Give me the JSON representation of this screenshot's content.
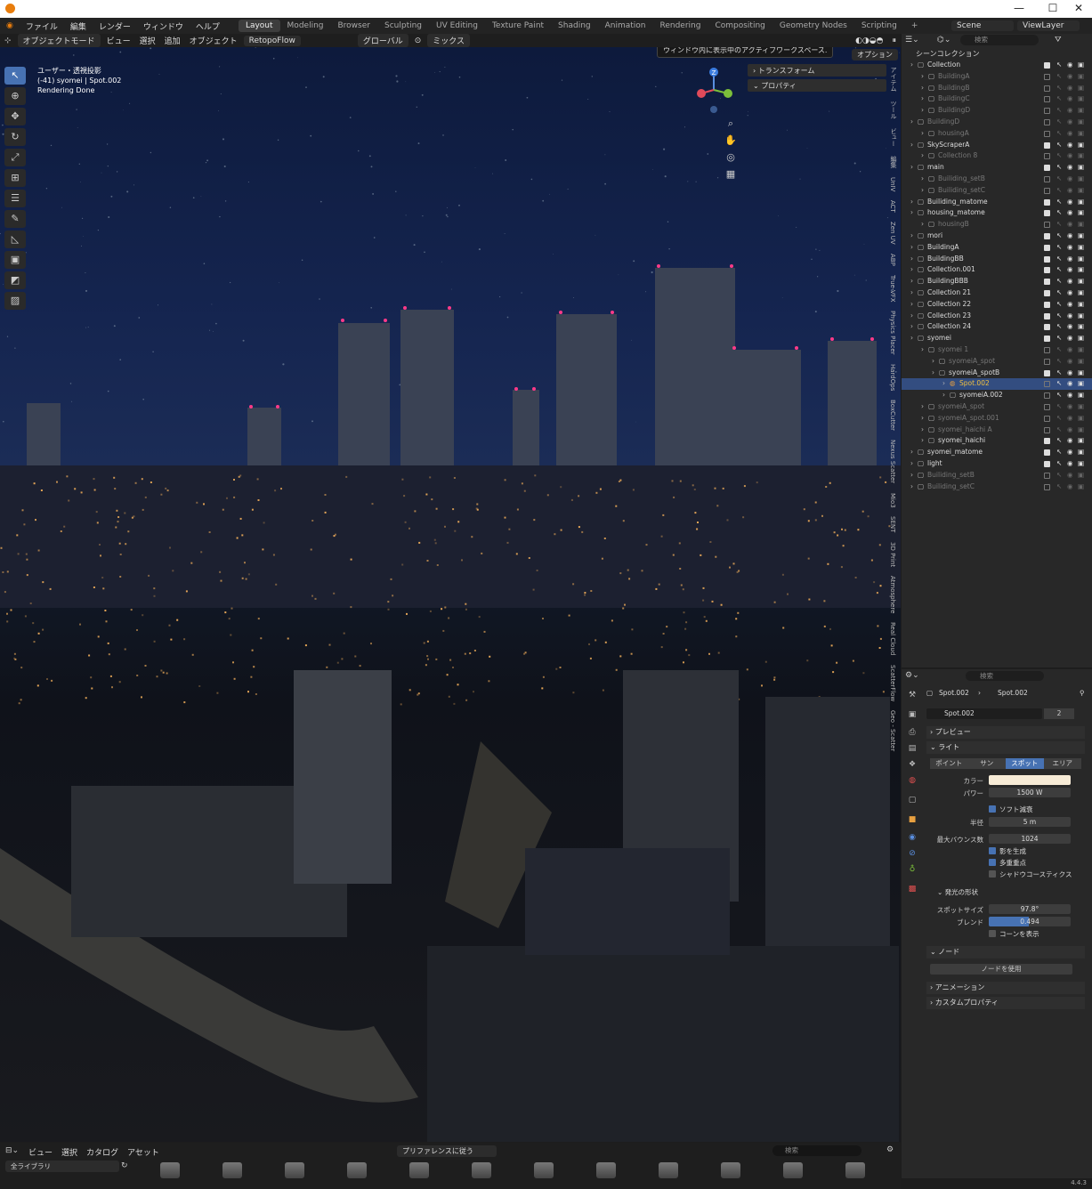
{
  "window": {
    "minimize": "—",
    "maximize": "☐",
    "close": "✕"
  },
  "menus": [
    "ファイル",
    "編集",
    "レンダー",
    "ウィンドウ",
    "ヘルプ"
  ],
  "workspaces": [
    "Layout",
    "Modeling",
    "Browser",
    "Sculpting",
    "UV Editing",
    "Texture Paint",
    "Shading",
    "Animation",
    "Rendering",
    "Compositing",
    "Geometry Nodes",
    "Scripting"
  ],
  "active_workspace": "Layout",
  "add_workspace": "+",
  "scene": {
    "name": "Scene",
    "view_layer": "ViewLayer"
  },
  "viewport_header": {
    "mode": "オブジェクトモード",
    "menu": [
      "ビュー",
      "選択",
      "追加",
      "オブジェクト"
    ],
    "addon": "RetopoFlow",
    "transform": "グローバル",
    "snap": "ミックス",
    "options": "オプション"
  },
  "tooltip": "ウィンドウ内に表示中のアクティブワークスペース.",
  "overlay": {
    "line1": "ユーザー・透視投影",
    "line2": "(-41) syomei | Spot.002",
    "line3": "Rendering Done"
  },
  "npanel": {
    "transform": "トランスフォーム",
    "properties": "プロパティ"
  },
  "gizmo": {
    "z": "Z"
  },
  "side_tabs": [
    "アイテム",
    "ツール",
    "ビュー",
    "編集",
    "UnIV",
    "ACT",
    "Zen UV",
    "ABP",
    "True-VFX",
    "Physics Placer",
    "HardOps",
    "BoxCutter",
    "Nexus Scatter",
    "Mio3",
    "SENT",
    "3D Print",
    "Atmosphere",
    "Real Cloud",
    "ScatterFlow",
    "Geo - Scatter"
  ],
  "outliner": {
    "search_placeholder": "検索",
    "root": "シーンコレクション",
    "rows": [
      {
        "name": "Collection",
        "indent": 1,
        "dim": false,
        "checked": true
      },
      {
        "name": "BuildingA",
        "indent": 2,
        "dim": true,
        "checked": false
      },
      {
        "name": "BuildingB",
        "indent": 2,
        "dim": true,
        "checked": false
      },
      {
        "name": "BuildingC",
        "indent": 2,
        "dim": true,
        "checked": false
      },
      {
        "name": "BuildingD",
        "indent": 2,
        "dim": true,
        "checked": false
      },
      {
        "name": "BuildingD",
        "indent": 1,
        "dim": true,
        "checked": false
      },
      {
        "name": "housingA",
        "indent": 2,
        "dim": true,
        "checked": false
      },
      {
        "name": "SkyScraperA",
        "indent": 1,
        "dim": false,
        "checked": true
      },
      {
        "name": "Collection 8",
        "indent": 2,
        "dim": true,
        "checked": false
      },
      {
        "name": "main",
        "indent": 1,
        "dim": false,
        "checked": true
      },
      {
        "name": "Builiding_setB",
        "indent": 2,
        "dim": true,
        "checked": false
      },
      {
        "name": "Builiding_setC",
        "indent": 2,
        "dim": true,
        "checked": false
      },
      {
        "name": "Builiding_matome",
        "indent": 1,
        "dim": false,
        "checked": true
      },
      {
        "name": "housing_matome",
        "indent": 1,
        "dim": false,
        "checked": true
      },
      {
        "name": "housingB",
        "indent": 2,
        "dim": true,
        "checked": false
      },
      {
        "name": "mori",
        "indent": 1,
        "dim": false,
        "checked": true
      },
      {
        "name": "BuildingA",
        "indent": 1,
        "dim": false,
        "checked": true
      },
      {
        "name": "BuildingBB",
        "indent": 1,
        "dim": false,
        "checked": true
      },
      {
        "name": "Collection.001",
        "indent": 1,
        "dim": false,
        "checked": true
      },
      {
        "name": "BuildingBBB",
        "indent": 1,
        "dim": false,
        "checked": true
      },
      {
        "name": "Collection 21",
        "indent": 1,
        "dim": false,
        "checked": true
      },
      {
        "name": "Collection 22",
        "indent": 1,
        "dim": false,
        "checked": true
      },
      {
        "name": "Collection 23",
        "indent": 1,
        "dim": false,
        "checked": true
      },
      {
        "name": "Collection 24",
        "indent": 1,
        "dim": false,
        "checked": true
      },
      {
        "name": "syomei",
        "indent": 1,
        "dim": false,
        "checked": true
      },
      {
        "name": "syomei 1",
        "indent": 2,
        "dim": true,
        "checked": false
      },
      {
        "name": "syomeiA_spot",
        "indent": 3,
        "dim": true,
        "checked": false
      },
      {
        "name": "syomeiA_spotB",
        "indent": 3,
        "dim": false,
        "checked": true
      },
      {
        "name": "Spot.002",
        "indent": 4,
        "dim": false,
        "checked": false,
        "selected": true
      },
      {
        "name": "syomeiA.002",
        "indent": 4,
        "dim": false,
        "checked": false
      },
      {
        "name": "syomeiA_spot",
        "indent": 2,
        "dim": true,
        "checked": false
      },
      {
        "name": "syomeiA_spot.001",
        "indent": 2,
        "dim": true,
        "checked": false
      },
      {
        "name": "syomei_haichi A",
        "indent": 2,
        "dim": true,
        "checked": false
      },
      {
        "name": "syomei_haichi",
        "indent": 2,
        "dim": false,
        "checked": true
      },
      {
        "name": "syomei_matome",
        "indent": 1,
        "dim": false,
        "checked": true
      },
      {
        "name": "light",
        "indent": 1,
        "dim": false,
        "checked": true
      },
      {
        "name": "Builiding_setB",
        "indent": 1,
        "dim": true,
        "checked": false
      },
      {
        "name": "Builiding_setC",
        "indent": 1,
        "dim": true,
        "checked": false
      }
    ]
  },
  "properties": {
    "search_placeholder": "検索",
    "breadcrumb": [
      "Spot.002",
      "Spot.002"
    ],
    "datablock": "Spot.002",
    "users": "2",
    "sections": {
      "preview": "プレビュー",
      "light": "ライト",
      "shape": "発光の形状",
      "nodes": "ノード",
      "animation": "アニメーション",
      "custom": "カスタムプロパティ"
    },
    "light_types": [
      "ポイント",
      "サン",
      "スポット",
      "エリア"
    ],
    "active_light_type": "スポット",
    "color_label": "カラー",
    "light_color": "#f7ebd6",
    "power_label": "パワー",
    "power": "1500 W",
    "soft_falloff": "ソフト減衰",
    "radius_label": "半径",
    "radius": "5 m",
    "max_bounces_label": "最大バウンス数",
    "max_bounces": "1024",
    "cast_shadow": "影を生成",
    "multiple_importance": "多重重点",
    "shadow_caustics": "シャドウコースティクス",
    "spot_size_label": "スポットサイズ",
    "spot_size": "97.8°",
    "blend_label": "ブレンド",
    "blend": "0.494",
    "blend_fraction": 0.494,
    "show_cone": "コーンを表示",
    "use_nodes": "ノードを使用"
  },
  "assets": {
    "menu": [
      "ビュー",
      "選択",
      "カタログ",
      "アセット"
    ],
    "import": "プリファレンスに従う",
    "library": "全ライブラリ",
    "search_placeholder": "検索"
  },
  "version": "4.4.3"
}
